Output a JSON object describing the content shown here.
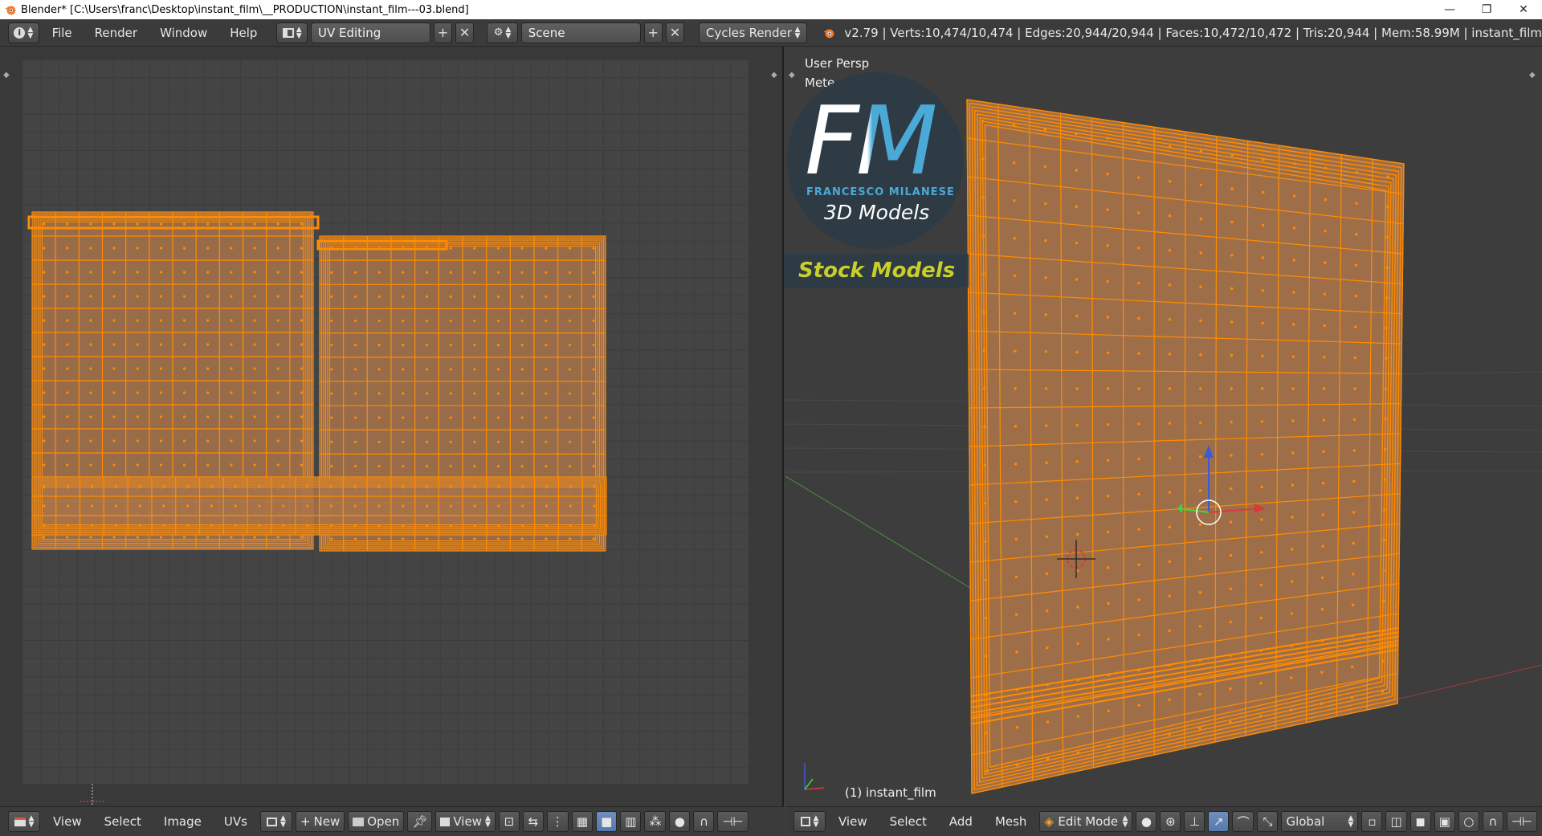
{
  "window": {
    "title": "Blender* [C:\\Users\\franc\\Desktop\\instant_film\\__PRODUCTION\\instant_film---03.blend]",
    "minimize": "—",
    "restore": "❐",
    "close": "✕"
  },
  "info_header": {
    "menus": [
      "File",
      "Render",
      "Window",
      "Help"
    ],
    "screen_layout": "UV Editing",
    "scene": "Scene",
    "render_engine": "Cycles Render",
    "stats": "v2.79 | Verts:10,474/10,474 | Edges:20,944/20,944 | Faces:10,472/10,472 | Tris:20,944 | Mem:58.99M | instant_film"
  },
  "viewport": {
    "view_name": "User Persp",
    "units": "Mete",
    "object_label": "(1) instant_film"
  },
  "logo": {
    "letters": "FM",
    "author": "FRANCESCO MILANESE",
    "line1": "3D Models",
    "line2": "Stock Models"
  },
  "uv_header": {
    "menus": [
      "View",
      "Select",
      "Image",
      "UVs"
    ],
    "new_label": "New",
    "open_label": "Open",
    "view_label": "View"
  },
  "view3d_header": {
    "menus": [
      "View",
      "Select",
      "Add",
      "Mesh"
    ],
    "mode": "Edit Mode",
    "orientation": "Global"
  },
  "colors": {
    "mesh_orange": "#ff8c00",
    "face_fill": "#a8734a",
    "panel_bg": "#3b3b3b",
    "logo_green": "#c8cf2a",
    "logo_blue": "#4aa9d6"
  }
}
